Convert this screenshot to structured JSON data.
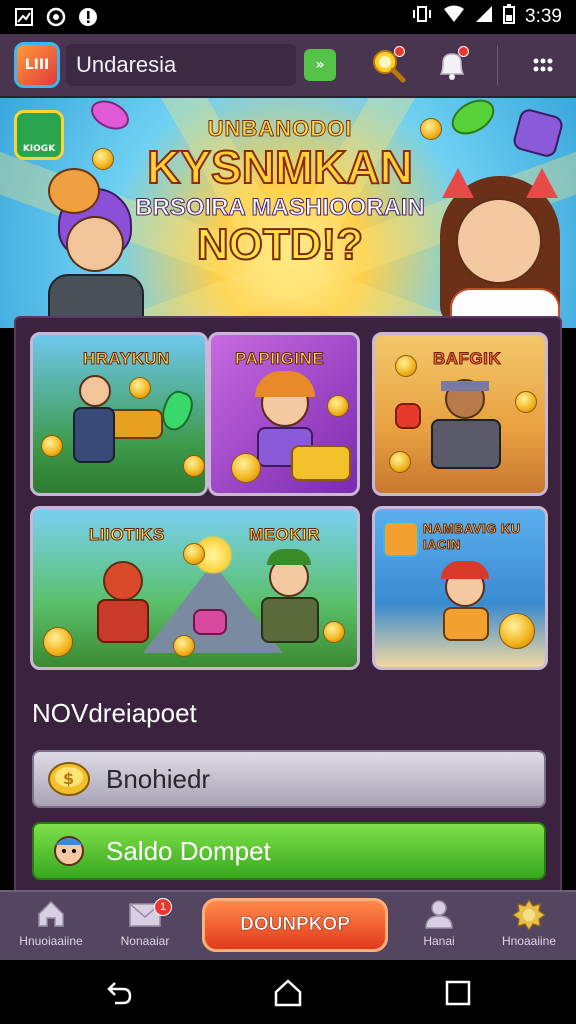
{
  "status_bar": {
    "time": "3:39"
  },
  "header": {
    "logo_text": "LIII",
    "title": "Undaresia",
    "chip_text": "»"
  },
  "hero": {
    "badge_text": "KIOGK",
    "line1": "UNBANODOI",
    "line2": "KYSNMKAN",
    "line3": "BRSOIRA MASHIOORAIN",
    "line4": "NOTD!?"
  },
  "cards": [
    {
      "title": "HRAYKUN"
    },
    {
      "title": "PAPIIGINE"
    },
    {
      "title": "BAFGIK"
    },
    {
      "title": "LIIOTIKS"
    },
    {
      "title": "MEOKIR"
    },
    {
      "title": "NAMBAVIG KU IACIN"
    }
  ],
  "section_title": "NOVdreiapoet",
  "buttons": {
    "primary": "Bnohiedr",
    "secondary": "Saldo Dompet"
  },
  "bottom_nav": {
    "items": [
      "Hnuoiaaiine",
      "Nonaaiar",
      "Hanai",
      "Hnoaaiine"
    ],
    "mail_badge": "1",
    "cta": "DOUNPKOP"
  },
  "colors": {
    "header_bg": "#4a3550",
    "panel_bg": "#3b2340",
    "accent_green": "#38a81e",
    "cta_orange": "#e23a1c"
  }
}
